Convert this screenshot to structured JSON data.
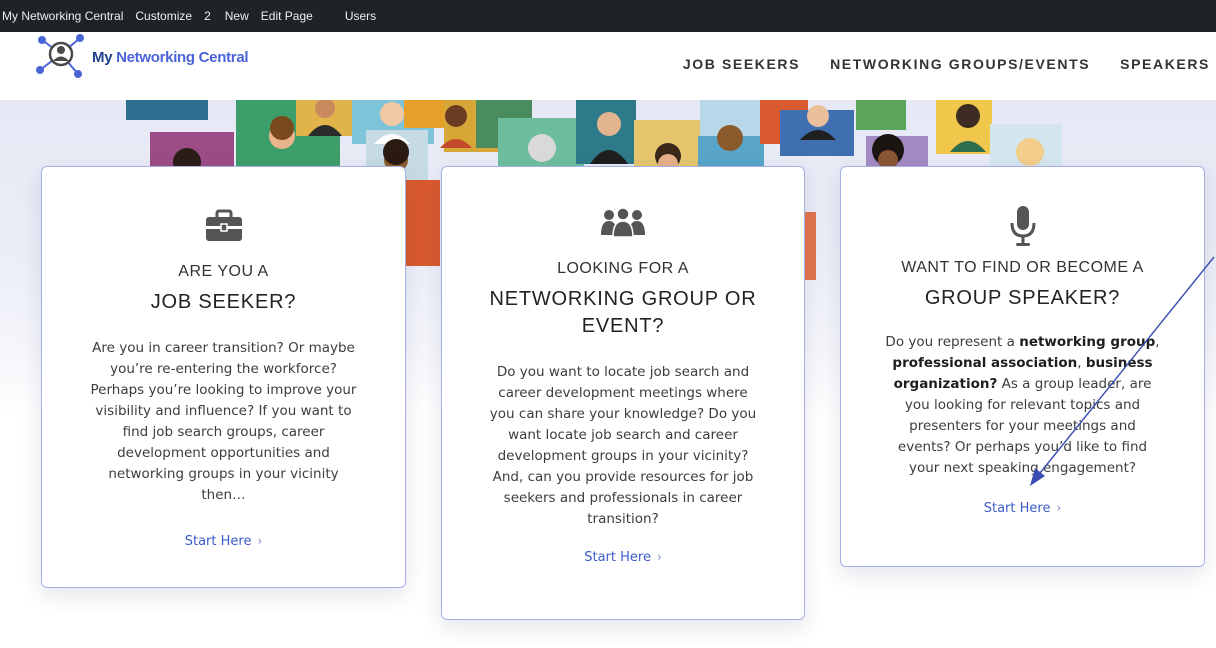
{
  "admin_bar": {
    "site": "My Networking Central",
    "customize": "Customize",
    "comments_count": "2",
    "new": "New",
    "edit_page": "Edit Page",
    "users": "Users"
  },
  "header": {
    "logo_text_part1": "My ",
    "logo_text_part2": "Networking Central",
    "nav": [
      "JOB SEEKERS",
      "NETWORKING GROUPS/EVENTS",
      "SPEAKERS"
    ]
  },
  "cards": [
    {
      "icon": "briefcase-icon",
      "kicker": "ARE YOU A",
      "title": "JOB SEEKER?",
      "body_lines": [
        "Are you in career transition? Or maybe",
        "you’re re-entering the workforce?",
        "Perhaps you’re looking to improve your",
        "visibility and influence? If you want to",
        "find job search groups, career",
        "development opportunities and",
        "networking groups in your vicinity",
        "then…"
      ],
      "cta": "Start Here"
    },
    {
      "icon": "group-icon",
      "kicker": "LOOKING FOR A",
      "title_line1": "NETWORKING GROUP OR",
      "title_line2": "EVENT?",
      "body_lines": [
        "Do you want to locate job search and",
        "career development meetings where",
        "you can share your knowledge? Do you",
        "want locate job search and career",
        "development groups in your vicinity?",
        "And, can you provide resources for job",
        "seekers and professionals in career",
        "transition?"
      ],
      "cta": "Start Here"
    },
    {
      "icon": "microphone-icon",
      "kicker": "WANT TO FIND OR BECOME A",
      "title": "GROUP SPEAKER?",
      "body": {
        "l1_a": "Do you represent a ",
        "l1_b": "networking group",
        "l1_c": ",",
        "l2_a": "professional association",
        "l2_b": ", ",
        "l2_c": "business",
        "l3_a": "organization?",
        "l3_b": "  As a group leader, are",
        "l4": "you looking for relevant topics and",
        "l5": "presenters for your meetings and",
        "l6": "events? Or perhaps you’d like to find",
        "l7": "your next speaking engagement?"
      },
      "cta": "Start Here"
    }
  ],
  "colors": {
    "accent": "#3c5bc9",
    "card_border": "#a7b0e6",
    "admin_bar": "#1d2327",
    "annotation_arrow": "#3a4db3"
  }
}
